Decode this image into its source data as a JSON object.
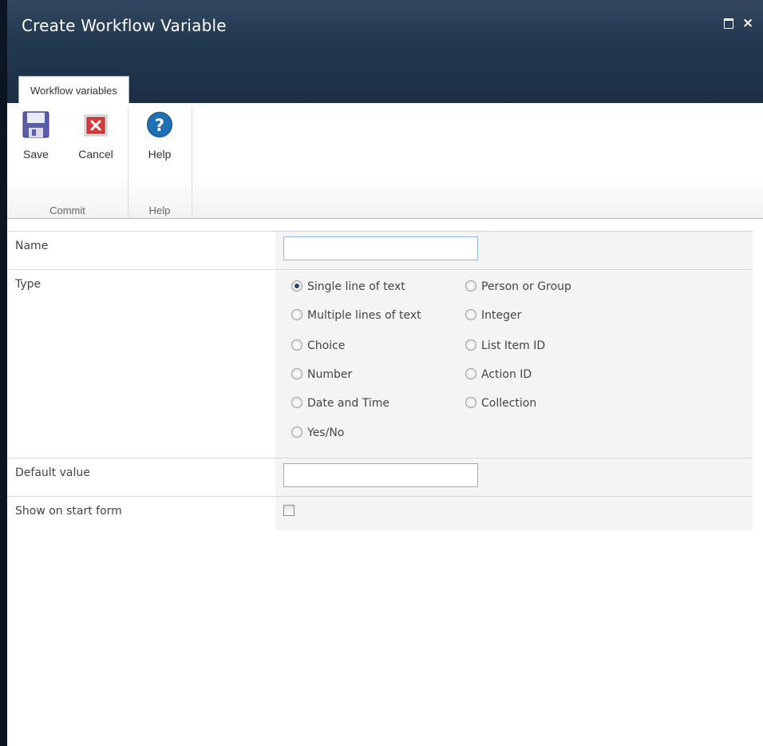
{
  "window": {
    "title": "Create Workflow Variable",
    "maximize_glyph": "□",
    "close_glyph": "×"
  },
  "ribbon": {
    "tab_label": "Workflow variables",
    "groups": [
      {
        "label": "Commit",
        "buttons": [
          {
            "label": "Save",
            "icon": "save-icon"
          },
          {
            "label": "Cancel",
            "icon": "cancel-icon"
          }
        ]
      },
      {
        "label": "Help",
        "buttons": [
          {
            "label": "Help",
            "icon": "help-icon"
          }
        ]
      }
    ]
  },
  "form": {
    "name": {
      "label": "Name",
      "value": ""
    },
    "type": {
      "label": "Type",
      "selected": "Single line of text",
      "options_col1": [
        "Single line of text",
        "Multiple lines of text",
        "Choice",
        "Number",
        "Date and Time",
        "Yes/No"
      ],
      "options_col2": [
        "Person or Group",
        "Integer",
        "List Item ID",
        "Action ID",
        "Collection"
      ]
    },
    "default_value": {
      "label": "Default value",
      "value": ""
    },
    "show_on_start_form": {
      "label": "Show on start form",
      "checked": false
    }
  },
  "colors": {
    "title_bar": "#22384f",
    "radio_selected": "#24456a",
    "field_bg": "#f4f4f4"
  }
}
